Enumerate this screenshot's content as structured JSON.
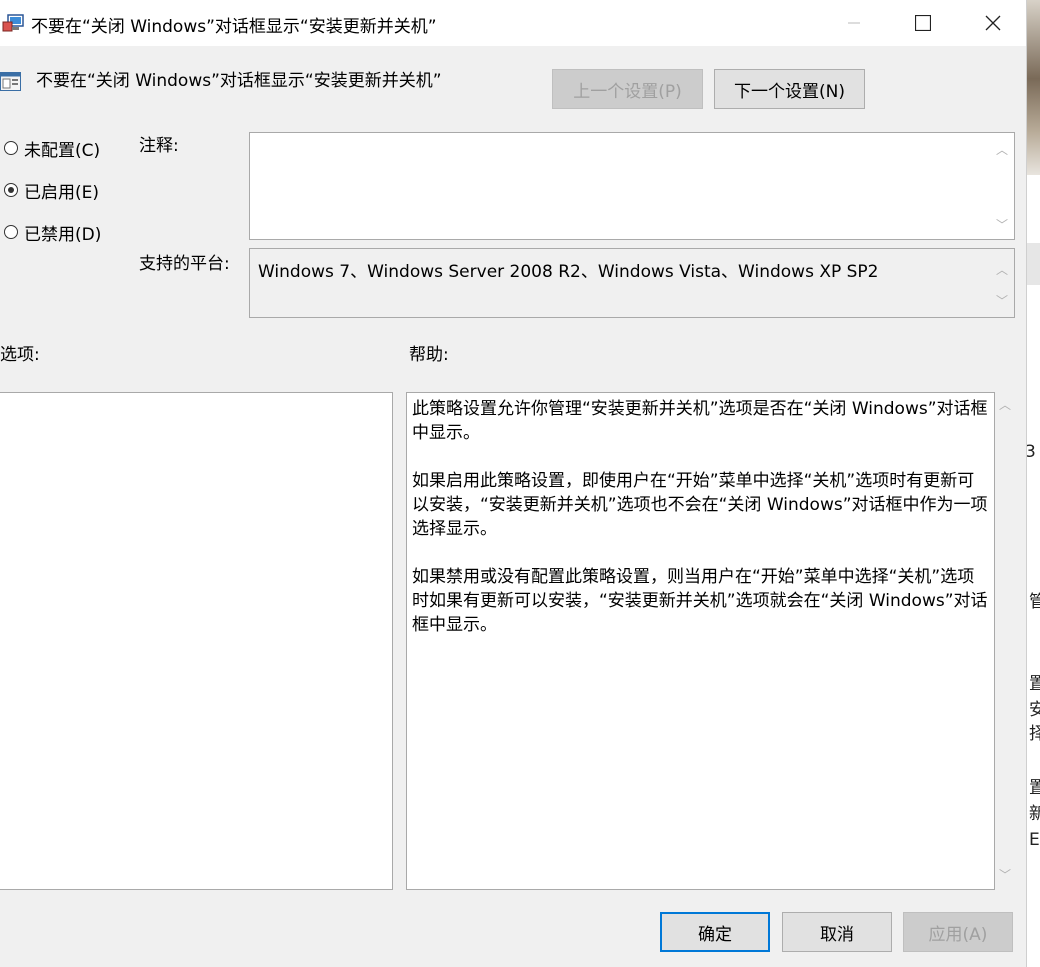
{
  "window": {
    "title": "不要在“关闭 Windows”对话框显示“安装更新并关机”",
    "controls": {
      "minimize": "—",
      "maximize": "☐",
      "close": "✕"
    }
  },
  "header": {
    "policy_name": "不要在“关闭 Windows”对话框显示“安装更新并关机”",
    "prev_setting": "上一个设置(P)",
    "next_setting": "下一个设置(N)"
  },
  "state": {
    "options": [
      {
        "label": "未配置(C)",
        "selected": false
      },
      {
        "label": "已启用(E)",
        "selected": true
      },
      {
        "label": "已禁用(D)",
        "selected": false
      }
    ]
  },
  "comment": {
    "label": "注释:",
    "value": ""
  },
  "platform": {
    "label": "支持的平台:",
    "value": "Windows 7、Windows Server 2008 R2、Windows Vista、Windows XP SP2"
  },
  "options_section": {
    "label": "选项:"
  },
  "help_section": {
    "label": "帮助:",
    "paragraphs": [
      "此策略设置允许你管理“安装更新并关机”选项是否在“关闭 Windows”对话框中显示。",
      "如果启用此策略设置，即使用户在“开始”菜单中选择“关机”选项时有更新可以安装，“安装更新并关机”选项也不会在“关闭 Windows”对话框中作为一项选择显示。",
      "如果禁用或没有配置此策略设置，则当用户在“开始”菜单中选择“关机”选项时如果有更新可以安装，“安装更新并关机”选项就会在“关闭 Windows”对话框中显示。"
    ]
  },
  "footer": {
    "ok": "确定",
    "cancel": "取消",
    "apply": "应用(A)"
  },
  "background_window_chars": [
    "3",
    "管",
    "置",
    "安",
    "择",
    "置",
    "新",
    "E"
  ],
  "colors": {
    "accent": "#0078d7",
    "window_bg": "#f0f0f0"
  }
}
